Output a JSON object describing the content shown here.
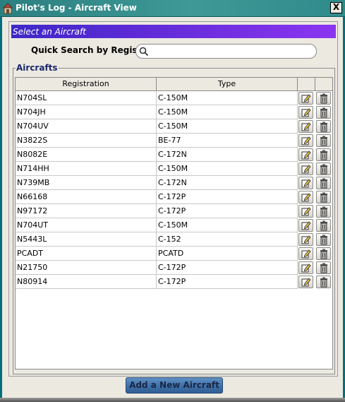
{
  "window": {
    "title": "Pilot's Log - Aircraft View",
    "close_label": "X"
  },
  "banner": {
    "text": "Select an Aircraft"
  },
  "search": {
    "label": "Quick Search by Registry",
    "value": "",
    "placeholder": ""
  },
  "group": {
    "legend": "Aircrafts"
  },
  "table": {
    "columns": [
      "Registration",
      "Type",
      "",
      ""
    ],
    "rows": [
      {
        "registration": "N704SL",
        "type": "C-150M"
      },
      {
        "registration": "N704JH",
        "type": "C-150M"
      },
      {
        "registration": "N704UV",
        "type": "C-150M"
      },
      {
        "registration": "N3822S",
        "type": "BE-77"
      },
      {
        "registration": "N8082E",
        "type": "C-172N"
      },
      {
        "registration": "N714HH",
        "type": "C-150M"
      },
      {
        "registration": "N739MB",
        "type": "C-172N"
      },
      {
        "registration": "N66168",
        "type": "C-172P"
      },
      {
        "registration": "N97172",
        "type": "C-172P"
      },
      {
        "registration": "N704UT",
        "type": "C-150M"
      },
      {
        "registration": "N5443L",
        "type": "C-152"
      },
      {
        "registration": "PCADT",
        "type": "PCATD"
      },
      {
        "registration": "N21750",
        "type": "C-172P"
      },
      {
        "registration": "N80914",
        "type": "C-172P"
      }
    ],
    "row_actions": {
      "edit_icon": "edit-icon",
      "delete_icon": "trash-icon"
    }
  },
  "footer": {
    "add_button_label": "Add a New Aircraft"
  },
  "colors": {
    "title_bar": "#2b7f80",
    "banner_start": "#3d27c7",
    "banner_end": "#8b35f0",
    "add_button": "#3f71aa"
  }
}
